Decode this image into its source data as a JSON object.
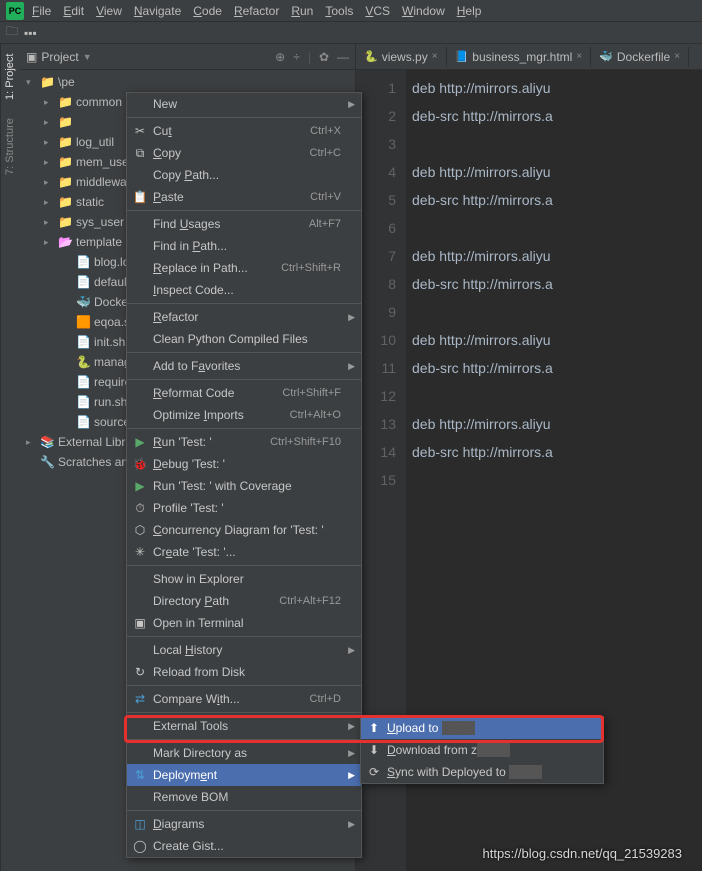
{
  "menubar": [
    "File",
    "Edit",
    "View",
    "Navigate",
    "Code",
    "Refactor",
    "Run",
    "Tools",
    "VCS",
    "Window",
    "Help"
  ],
  "sidebar_tabs": {
    "project": "1: Project",
    "structure": "7: Structure"
  },
  "project_header": {
    "title": "Project"
  },
  "tree": [
    {
      "indent": 0,
      "arrow": "▾",
      "icon": "📁",
      "label": "\\pe",
      "path": true
    },
    {
      "indent": 1,
      "arrow": "▸",
      "icon": "📁",
      "label": "common"
    },
    {
      "indent": 1,
      "arrow": "▸",
      "icon": "📁",
      "label": ""
    },
    {
      "indent": 1,
      "arrow": "▸",
      "icon": "📁",
      "label": "log_util"
    },
    {
      "indent": 1,
      "arrow": "▸",
      "icon": "📁",
      "label": "mem_use"
    },
    {
      "indent": 1,
      "arrow": "▸",
      "icon": "📁",
      "label": "middlewa"
    },
    {
      "indent": 1,
      "arrow": "▸",
      "icon": "📁",
      "label": "static"
    },
    {
      "indent": 1,
      "arrow": "▸",
      "icon": "📁",
      "label": "sys_user"
    },
    {
      "indent": 1,
      "arrow": "▸",
      "icon": "📂",
      "label": "template",
      "purple": true
    },
    {
      "indent": 2,
      "arrow": "",
      "icon": "📄",
      "label": "blog.log"
    },
    {
      "indent": 2,
      "arrow": "",
      "icon": "📄",
      "label": "default.c"
    },
    {
      "indent": 2,
      "arrow": "",
      "icon": "🐳",
      "label": "Dockerfil"
    },
    {
      "indent": 2,
      "arrow": "",
      "icon": "🟧",
      "label": "eqoa.sql"
    },
    {
      "indent": 2,
      "arrow": "",
      "icon": "📄",
      "label": "init.sh"
    },
    {
      "indent": 2,
      "arrow": "",
      "icon": "🐍",
      "label": "manage."
    },
    {
      "indent": 2,
      "arrow": "",
      "icon": "📄",
      "label": "requirem"
    },
    {
      "indent": 2,
      "arrow": "",
      "icon": "📄",
      "label": "run.sh"
    },
    {
      "indent": 2,
      "arrow": "",
      "icon": "📄",
      "label": "sources.l"
    },
    {
      "indent": 0,
      "arrow": "▸",
      "icon": "📚",
      "label": "External Libr"
    },
    {
      "indent": 0,
      "arrow": "",
      "icon": "🔧",
      "label": "Scratches an"
    }
  ],
  "editor_tabs": [
    {
      "icon": "🐍",
      "label": "views.py"
    },
    {
      "icon": "📘",
      "label": "business_mgr.html"
    },
    {
      "icon": "🐳",
      "label": "Dockerfile"
    }
  ],
  "gutter": [
    "1",
    "2",
    "3",
    "4",
    "5",
    "6",
    "7",
    "8",
    "9",
    "10",
    "11",
    "12",
    "13",
    "14",
    "15"
  ],
  "code_lines": [
    "deb http://mirrors.aliyu",
    "deb-src http://mirrors.a",
    "",
    "deb http://mirrors.aliyu",
    "deb-src http://mirrors.a",
    "",
    "deb http://mirrors.aliyu",
    "deb-src http://mirrors.a",
    "",
    "deb http://mirrors.aliyu",
    "deb-src http://mirrors.a",
    "",
    "deb http://mirrors.aliyu",
    "deb-src http://mirrors.a",
    ""
  ],
  "ctx": [
    {
      "label": "New",
      "sub": true
    },
    {
      "sep": true
    },
    {
      "icon": "✂",
      "label": "Cut",
      "sc": "Ctrl+X",
      "u": 2
    },
    {
      "icon": "⧉",
      "label": "Copy",
      "sc": "Ctrl+C",
      "u": 0
    },
    {
      "label": "Copy Path...",
      "u": 5
    },
    {
      "icon": "📋",
      "label": "Paste",
      "sc": "Ctrl+V",
      "u": 0
    },
    {
      "sep": true
    },
    {
      "label": "Find Usages",
      "sc": "Alt+F7",
      "u": 5
    },
    {
      "label": "Find in Path...",
      "u": 8
    },
    {
      "label": "Replace in Path...",
      "sc": "Ctrl+Shift+R",
      "u": 0
    },
    {
      "label": "Inspect Code...",
      "u": 0
    },
    {
      "sep": true
    },
    {
      "label": "Refactor",
      "sub": true,
      "u": 0
    },
    {
      "label": "Clean Python Compiled Files"
    },
    {
      "sep": true
    },
    {
      "label": "Add to Favorites",
      "sub": true,
      "u": 8
    },
    {
      "sep": true
    },
    {
      "label": "Reformat Code",
      "sc": "Ctrl+Shift+F",
      "u": 0
    },
    {
      "label": "Optimize Imports",
      "sc": "Ctrl+Alt+O",
      "u": 9
    },
    {
      "sep": true
    },
    {
      "icon": "▶",
      "iconColor": "#59a869",
      "label": "Run 'Test: '",
      "sc": "Ctrl+Shift+F10",
      "u": 0
    },
    {
      "icon": "🐞",
      "iconColor": "#8fbf5a",
      "label": "Debug 'Test: '",
      "u": 0
    },
    {
      "icon": "▶",
      "iconColor": "#59a869",
      "label": "Run 'Test: ' with Coverage"
    },
    {
      "icon": "⏱",
      "label": "Profile 'Test: '"
    },
    {
      "icon": "⬡",
      "label": "Concurrency Diagram for 'Test: '",
      "u": 0
    },
    {
      "icon": "✳",
      "label": "Create 'Test: '...",
      "u": 2
    },
    {
      "sep": true
    },
    {
      "label": "Show in Explorer"
    },
    {
      "label": "Directory Path",
      "sc": "Ctrl+Alt+F12",
      "u": 10
    },
    {
      "icon": "▣",
      "label": "Open in Terminal"
    },
    {
      "sep": true
    },
    {
      "label": "Local History",
      "sub": true,
      "u": 6
    },
    {
      "icon": "↻",
      "label": "Reload from Disk"
    },
    {
      "sep": true
    },
    {
      "icon": "⇄",
      "iconColor": "#4aa0d6",
      "label": "Compare With...",
      "sc": "Ctrl+D",
      "u": 9
    },
    {
      "sep": true
    },
    {
      "label": "External Tools",
      "sub": true
    },
    {
      "sep": true
    },
    {
      "label": "Mark Directory as",
      "sub": true
    },
    {
      "icon": "⇅",
      "iconColor": "#4aa0d6",
      "label": "Deployment",
      "sub": true,
      "hover": true,
      "u": 7
    },
    {
      "label": "Remove BOM"
    },
    {
      "sep": true
    },
    {
      "icon": "◫",
      "iconColor": "#4aa0d6",
      "label": "Diagrams",
      "sub": true,
      "u": 0
    },
    {
      "icon": "◯",
      "label": "Create Gist..."
    }
  ],
  "submenu": [
    {
      "icon": "⬆",
      "label": "Upload to ",
      "hover": true,
      "u": 0
    },
    {
      "icon": "⬇",
      "label": "Download from z",
      "u": 0
    },
    {
      "icon": "⟳",
      "label": "Sync with Deployed to ",
      "u": 0
    }
  ],
  "watermark": "https://blog.csdn.net/qq_21539283"
}
